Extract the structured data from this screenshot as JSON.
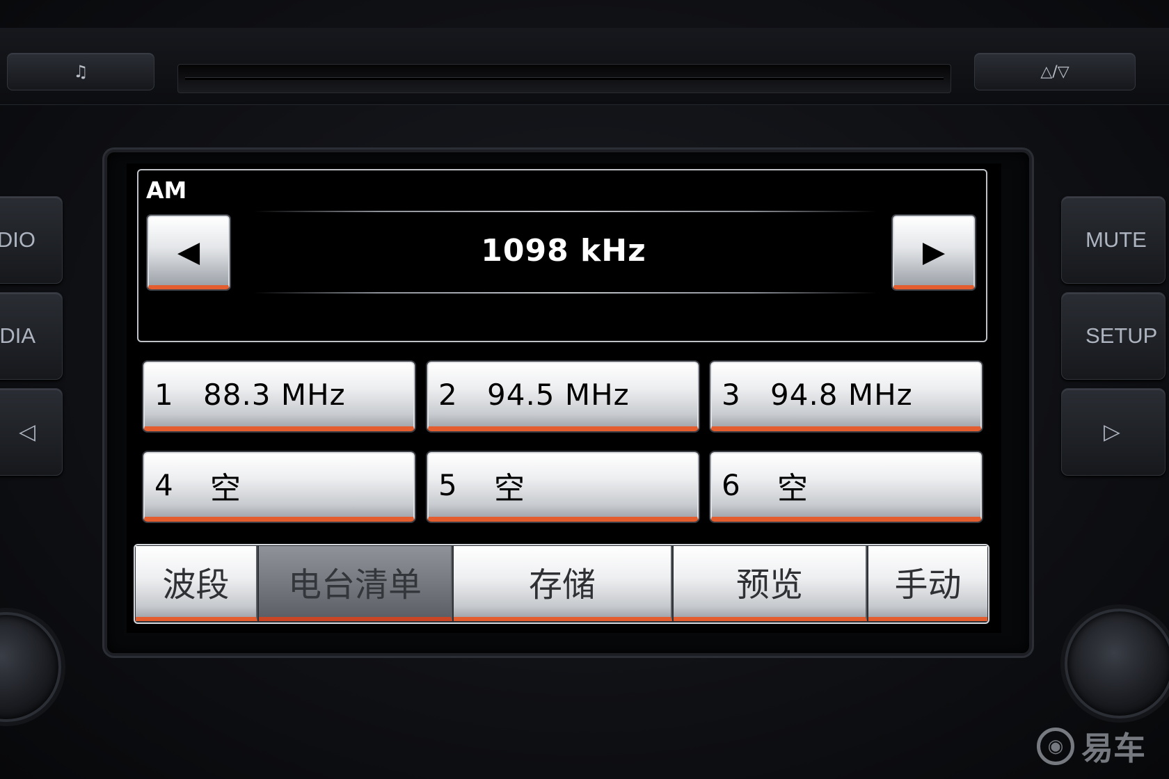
{
  "hardware": {
    "top_left_icon": "music-note-icon",
    "top_left_glyph": "♫",
    "eject_label": "△/▽",
    "left_buttons": [
      "DIO",
      "DIA",
      "◁"
    ],
    "right_buttons": [
      "MUTE",
      "SETUP",
      "▷"
    ]
  },
  "screen": {
    "band": "AM",
    "frequency": "1098 kHz",
    "prev_glyph": "◀",
    "next_glyph": "▶",
    "presets": [
      {
        "num": "1",
        "value": "88.3 MHz"
      },
      {
        "num": "2",
        "value": "94.5 MHz"
      },
      {
        "num": "3",
        "value": "94.8 MHz"
      },
      {
        "num": "4",
        "value": "空"
      },
      {
        "num": "5",
        "value": "空"
      },
      {
        "num": "6",
        "value": "空"
      }
    ],
    "tabs": [
      {
        "label": "波段",
        "active": false
      },
      {
        "label": "电台清单",
        "active": true
      },
      {
        "label": "存储",
        "active": false
      },
      {
        "label": "预览",
        "active": false
      },
      {
        "label": "手动",
        "active": false
      }
    ]
  },
  "colors": {
    "accent": "#e35d2e",
    "screen_bg": "#000000",
    "button_face": "#eeeff1"
  },
  "watermark": {
    "text": "易车"
  }
}
